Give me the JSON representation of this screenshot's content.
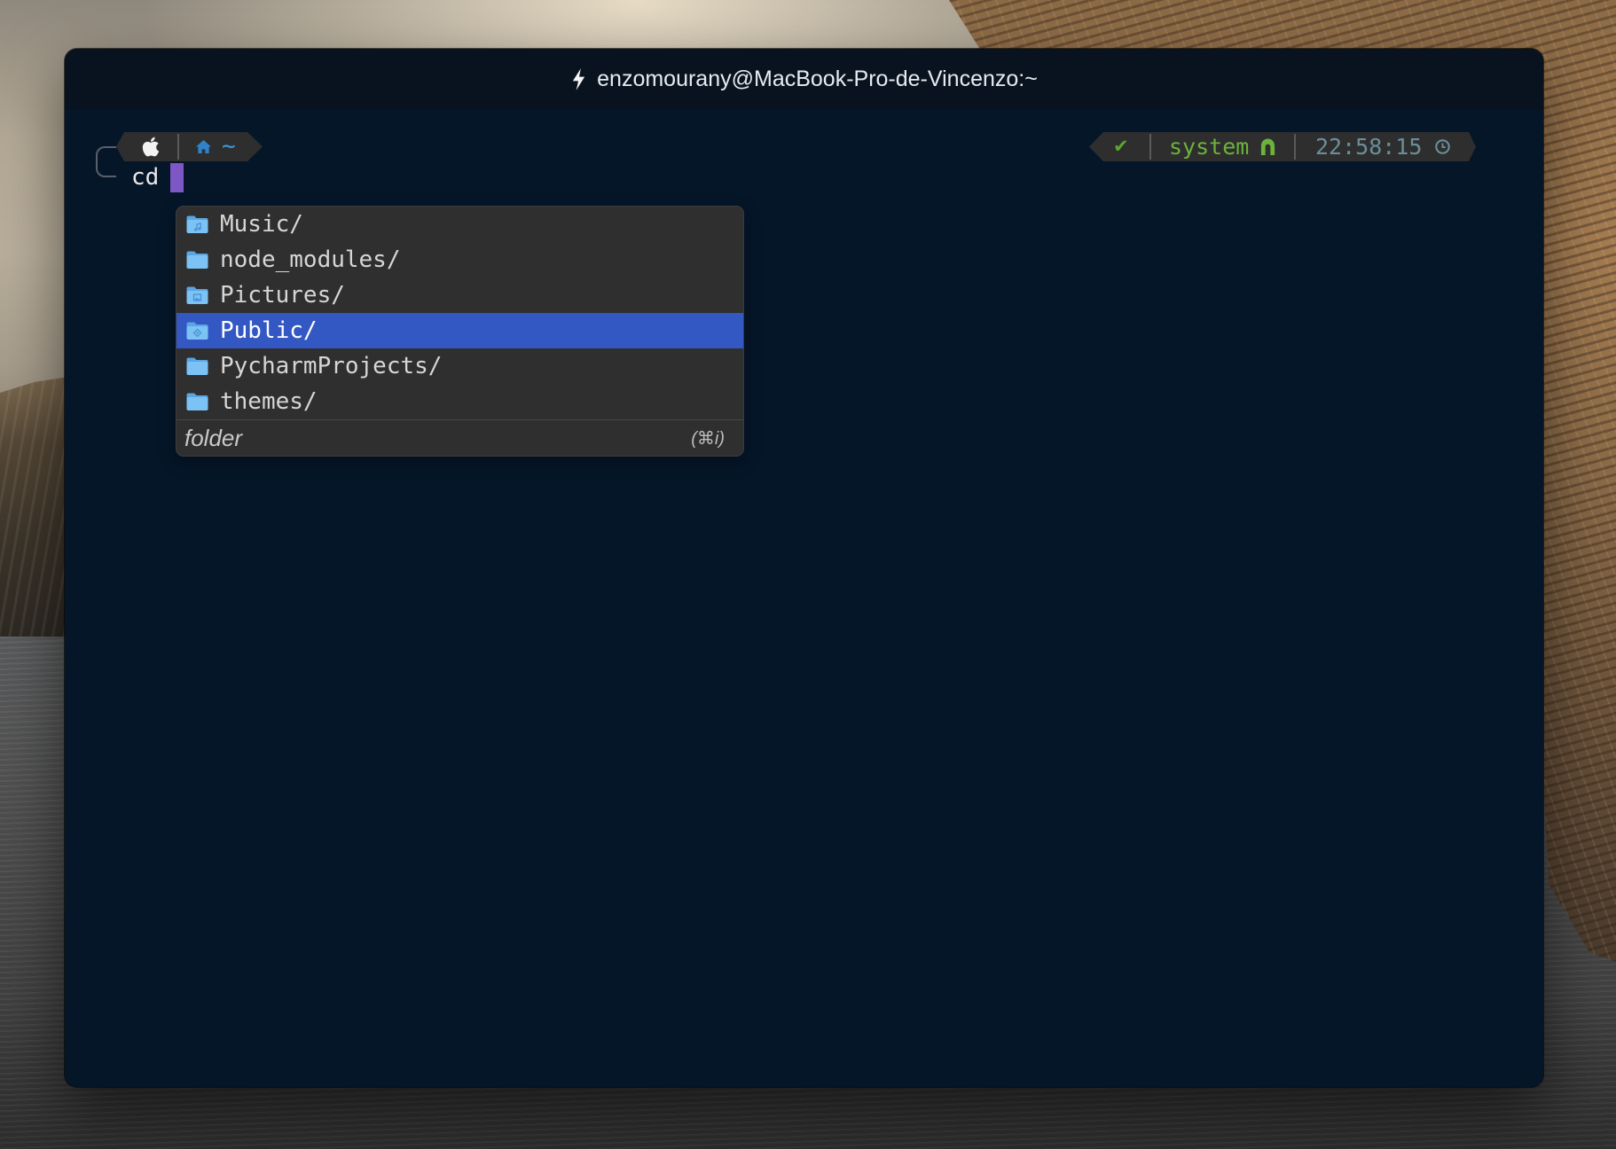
{
  "window": {
    "title": "enzomourany@MacBook-Pro-de-Vincenzo:~",
    "title_icon": "lightning-bolt-icon"
  },
  "prompt": {
    "left_segment": {
      "os_icon": "apple-icon",
      "dir_icon": "home-icon",
      "path": "~"
    },
    "input": {
      "command": "cd"
    },
    "right_segment": {
      "status_symbol": "✔",
      "env_name": "system",
      "env_icon": "arch-icon",
      "time": "22:58:15",
      "time_icon": "clock-icon"
    }
  },
  "completion_menu": {
    "items": [
      {
        "label": "Music/",
        "icon": "music-folder-icon",
        "selected": false
      },
      {
        "label": "node_modules/",
        "icon": "folder-icon",
        "selected": false
      },
      {
        "label": "Pictures/",
        "icon": "pictures-folder-icon",
        "selected": false
      },
      {
        "label": "Public/",
        "icon": "public-folder-icon",
        "selected": true
      },
      {
        "label": "PycharmProjects/",
        "icon": "folder-icon",
        "selected": false
      },
      {
        "label": "themes/",
        "icon": "folder-icon",
        "selected": false
      }
    ],
    "footer": {
      "description": "folder",
      "shortcut": "(⌘i)"
    }
  },
  "colors": {
    "term_bg": "#051629",
    "titlebar_bg": "#09131f",
    "seg_bg": "#2e2e2e",
    "seg_divider": "#5a5a5a",
    "cursor": "#7e57c6",
    "path_blue": "#3a9ad9",
    "home_blue": "#2f83c8",
    "status_green": "#58a630",
    "env_green": "#6bb33b",
    "time_text": "#6a8e99",
    "menu_bg": "#2f2f2f",
    "menu_selection": "#3358c4",
    "menu_text": "#d6d6d6",
    "folder_icon": "#7cc2f4",
    "folder_back": "#5aa6e2",
    "folder_mark": "#4a93d3"
  }
}
